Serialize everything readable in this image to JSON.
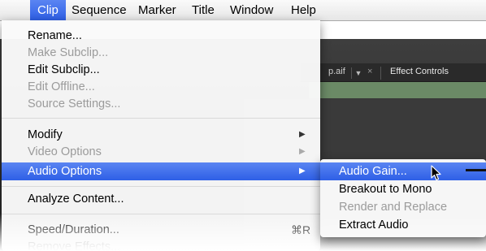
{
  "menubar": {
    "items": [
      {
        "label": "Clip",
        "active": true
      },
      {
        "label": "Sequence"
      },
      {
        "label": "Marker"
      },
      {
        "label": "Title"
      },
      {
        "label": "Window"
      },
      {
        "label": "Help"
      }
    ]
  },
  "background": {
    "tab_file_label": "p.aif",
    "tab_close_glyph": "×",
    "tab_dropdown_glyph": "▼",
    "tab_effect_controls_label": "Effect Controls"
  },
  "clip_menu": {
    "rename": "Rename...",
    "make_subclip": "Make Subclip...",
    "edit_subclip": "Edit Subclip...",
    "edit_offline": "Edit Offline...",
    "source_settings": "Source Settings...",
    "modify": "Modify",
    "video_options": "Video Options",
    "audio_options": "Audio Options",
    "analyze_content": "Analyze Content...",
    "speed_duration": "Speed/Duration...",
    "speed_duration_shortcut": "⌘R",
    "remove_effects": "Remove Effects...",
    "submenu_arrow": "▶"
  },
  "audio_options_submenu": {
    "audio_gain": "Audio Gain...",
    "breakout_to_mono": "Breakout to Mono",
    "render_and_replace": "Render and Replace",
    "extract_audio": "Extract Audio"
  },
  "colors": {
    "highlight": "#2e5fe6",
    "disabled_text": "#9b9b9b"
  },
  "icons": {
    "cursor": "arrow-pointer-icon",
    "submenu_arrow": "triangle-right-icon"
  }
}
